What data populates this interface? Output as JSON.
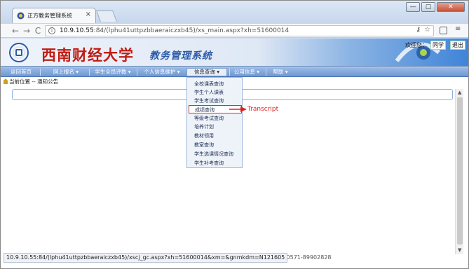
{
  "browser": {
    "tab_title": "正方教务管理系统",
    "tab_close": "×",
    "new_tab": "",
    "window_controls": {
      "minimize": "—",
      "restore": "▢",
      "close": "✕"
    },
    "nav": {
      "back": "←",
      "forward": "→",
      "reload": "C"
    },
    "address": {
      "host": "10.9.10.55",
      "path": ":84/(lphu41uttpzbbaeraiczxb45)/xs_main.aspx?xh=51600014",
      "key_icon": "key-icon",
      "star_icon": "star-icon"
    },
    "menu_glyph": "≡"
  },
  "header": {
    "university": "西南财经大学",
    "system_name": "教务管理系统",
    "welcome": "欢迎您：",
    "user": "同学",
    "logout": "退出"
  },
  "menu": {
    "items": [
      {
        "label": "返回首页"
      },
      {
        "label": "网上报名 ▾"
      },
      {
        "label": "学生全员评教 ▾"
      },
      {
        "label": "个人信息维护 ▾"
      },
      {
        "label": "信息查询 ▾"
      },
      {
        "label": "公用信息 ▾"
      },
      {
        "label": "帮助 ▾"
      }
    ],
    "active_index": 4
  },
  "breadcrumb": "当前位置 -- 通知公告",
  "dropdown": {
    "items": [
      "全校课表查询",
      "学生个人课表",
      "学生考试查询",
      "成绩查询",
      "等级考试查询",
      "培养计划",
      "教材领用",
      "教室查询",
      "学生选课情况查询",
      "学生补考查询"
    ],
    "selected_index": 3
  },
  "annotation": {
    "text": "Transcript",
    "color": "#e02020"
  },
  "footer": "有  联系电话：0571-89902828",
  "status_url": "10.9.10.55:84/(lphu41uttpzbbaeraiczxb45)/xscj_gc.aspx?xh=51600014&xm=&gnmkdm=N121605",
  "scroll": {
    "up": "▲",
    "down": "▼"
  },
  "colors": {
    "accent": "#2a5aa8",
    "brand_red": "#c01c12",
    "menu_bar": "#6f98d3"
  }
}
